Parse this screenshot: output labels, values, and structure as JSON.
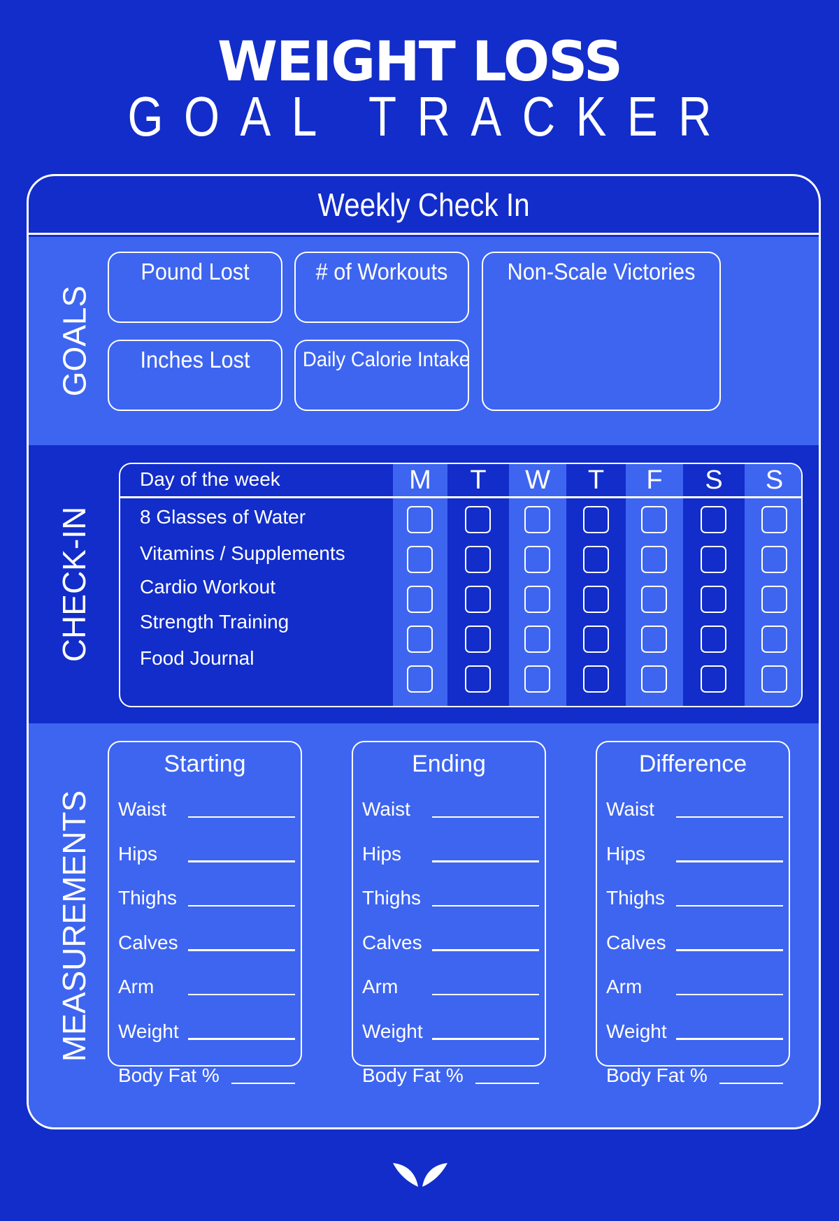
{
  "title": {
    "line1": "WEIGHT LOSS",
    "line2": "GOAL TRACKER"
  },
  "card": {
    "header": "Weekly Check In"
  },
  "colors": {
    "background": "#122dc9",
    "light_band": "#3e65f0",
    "foreground": "#ffffff"
  },
  "goals": {
    "section_label": "GOALS",
    "boxes": [
      {
        "label": "Pound Lost"
      },
      {
        "label": "# of Workouts"
      },
      {
        "label": "Non-Scale Victories"
      },
      {
        "label": "Inches Lost"
      },
      {
        "label": "Daily Calorie Intake"
      }
    ]
  },
  "checkin": {
    "section_label": "CHECK-IN",
    "header_label": "Day of the week",
    "days": [
      "M",
      "T",
      "W",
      "T",
      "F",
      "S",
      "S"
    ],
    "rows": [
      {
        "label": "8 Glasses of Water",
        "checked": [
          false,
          false,
          false,
          false,
          false,
          false,
          false
        ]
      },
      {
        "label": "Vitamins / Supplements",
        "checked": [
          false,
          false,
          false,
          false,
          false,
          false,
          false
        ]
      },
      {
        "label": "Cardio Workout",
        "checked": [
          false,
          false,
          false,
          false,
          false,
          false,
          false
        ]
      },
      {
        "label": "Strength Training",
        "checked": [
          false,
          false,
          false,
          false,
          false,
          false,
          false
        ]
      },
      {
        "label": "Food Journal",
        "checked": [
          false,
          false,
          false,
          false,
          false,
          false,
          false
        ]
      }
    ]
  },
  "measurements": {
    "section_label": "MEASUREMENTS",
    "columns": [
      {
        "title": "Starting",
        "fields": [
          {
            "label": "Waist",
            "value": ""
          },
          {
            "label": "Hips",
            "value": ""
          },
          {
            "label": "Thighs",
            "value": ""
          },
          {
            "label": "Calves",
            "value": ""
          },
          {
            "label": "Arm",
            "value": ""
          },
          {
            "label": "Weight",
            "value": ""
          },
          {
            "label": "Body Fat %",
            "value": ""
          }
        ]
      },
      {
        "title": "Ending",
        "fields": [
          {
            "label": "Waist",
            "value": ""
          },
          {
            "label": "Hips",
            "value": ""
          },
          {
            "label": "Thighs",
            "value": ""
          },
          {
            "label": "Calves",
            "value": ""
          },
          {
            "label": "Arm",
            "value": ""
          },
          {
            "label": "Weight",
            "value": ""
          },
          {
            "label": "Body Fat %",
            "value": ""
          }
        ]
      },
      {
        "title": "Difference",
        "fields": [
          {
            "label": "Waist",
            "value": ""
          },
          {
            "label": "Hips",
            "value": ""
          },
          {
            "label": "Thighs",
            "value": ""
          },
          {
            "label": "Calves",
            "value": ""
          },
          {
            "label": "Arm",
            "value": ""
          },
          {
            "label": "Weight",
            "value": ""
          },
          {
            "label": "Body Fat %",
            "value": ""
          }
        ]
      }
    ]
  },
  "footer": {
    "logo_icon": "leaf-wings-logo-icon"
  }
}
